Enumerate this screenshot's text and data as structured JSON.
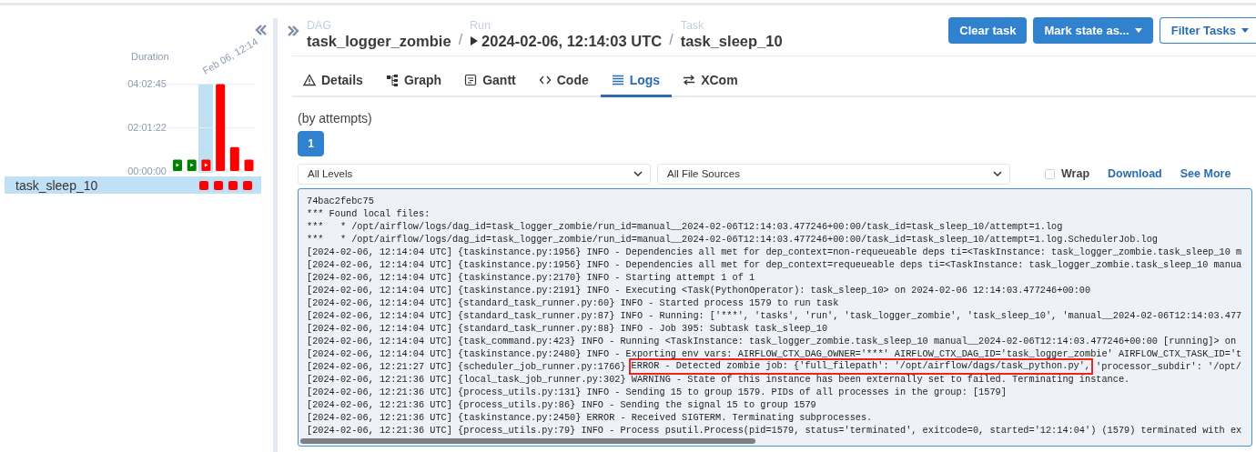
{
  "sidebar": {
    "chart_data": {
      "type": "bar",
      "ylabel": "Duration",
      "ylim": [
        0,
        14565
      ],
      "yticks": [
        {
          "value": 0,
          "label": "00:00:00"
        },
        {
          "value": 7282,
          "label": "02:01:22"
        },
        {
          "value": 14565,
          "label": "04:02:45"
        }
      ],
      "values": [
        1900,
        1900,
        1900,
        14500,
        4000,
        1900
      ]
    },
    "runs": [
      {
        "color": "#008000",
        "manual": true,
        "selected": false
      },
      {
        "color": "#008000",
        "manual": true,
        "selected": false
      },
      {
        "color": "#ff0000",
        "manual": true,
        "selected": true,
        "date_label": "Feb 06, 12:14"
      },
      {
        "color": "#ff0000",
        "manual": false,
        "selected": false
      },
      {
        "color": "#ff0000",
        "manual": false,
        "selected": false
      },
      {
        "color": "#ff0000",
        "manual": false,
        "selected": false
      }
    ],
    "task_row": {
      "label": "task_sleep_10",
      "selected": true,
      "instances": [
        {
          "kind": "empty"
        },
        {
          "kind": "empty"
        },
        {
          "kind": "square",
          "color": "#ff0000"
        },
        {
          "kind": "square",
          "color": "#ff0000"
        },
        {
          "kind": "square",
          "color": "#ff0000"
        },
        {
          "kind": "square",
          "color": "#ff0000"
        }
      ]
    }
  },
  "breadcrumb": [
    {
      "label": "DAG",
      "value": "task_logger_zombie",
      "kind": "text"
    },
    {
      "separator": "/",
      "label": "Run",
      "value": "2024-02-06, 12:14:03 UTC",
      "kind": "run"
    },
    {
      "separator": "/",
      "label": "Task",
      "value": "task_sleep_10",
      "kind": "text"
    }
  ],
  "actions": [
    {
      "label": "Clear task",
      "kind": "primary"
    },
    {
      "label": "Mark state as...",
      "kind": "primary-dropdown"
    },
    {
      "label": "Filter Tasks",
      "kind": "outline-dropdown"
    }
  ],
  "tabs": [
    {
      "label": "Details",
      "selected": false
    },
    {
      "label": "Graph",
      "selected": false
    },
    {
      "label": "Gantt",
      "selected": false
    },
    {
      "label": "Code",
      "selected": false
    },
    {
      "label": "Logs",
      "selected": true
    },
    {
      "label": "XCom",
      "selected": false
    }
  ],
  "logs": {
    "attempts_label": "(by attempts)",
    "attempts": [
      {
        "label": "1",
        "selected": true
      }
    ],
    "level_select": "All Levels",
    "source_select": "All File Sources",
    "wrap": {
      "label": "Wrap",
      "checked": false
    },
    "links": [
      "Download",
      "See More"
    ],
    "lines": [
      {
        "text": "74bac2febc75"
      },
      {
        "text": "*** Found local files:"
      },
      {
        "text": "***   * /opt/airflow/logs/dag_id=task_logger_zombie/run_id=manual__2024-02-06T12:14:03.477246+00:00/task_id=task_sleep_10/attempt=1.log"
      },
      {
        "text": "***   * /opt/airflow/logs/dag_id=task_logger_zombie/run_id=manual__2024-02-06T12:14:03.477246+00:00/task_id=task_sleep_10/attempt=1.log.SchedulerJob.log"
      },
      {
        "text": "[2024-02-06, 12:14:04 UTC] {taskinstance.py:1956} INFO - Dependencies all met for dep_context=non-requeueable deps ti=<TaskInstance: task_logger_zombie.task_sleep_10 m"
      },
      {
        "text": "[2024-02-06, 12:14:04 UTC] {taskinstance.py:1956} INFO - Dependencies all met for dep_context=requeueable deps ti=<TaskInstance: task_logger_zombie.task_sleep_10 manua"
      },
      {
        "text": "[2024-02-06, 12:14:04 UTC] {taskinstance.py:2170} INFO - Starting attempt 1 of 1"
      },
      {
        "text": "[2024-02-06, 12:14:04 UTC] {taskinstance.py:2191} INFO - Executing <Task(PythonOperator): task_sleep_10> on 2024-02-06 12:14:03.477246+00:00"
      },
      {
        "text": "[2024-02-06, 12:14:04 UTC] {standard_task_runner.py:60} INFO - Started process 1579 to run task"
      },
      {
        "text": "[2024-02-06, 12:14:04 UTC] {standard_task_runner.py:87} INFO - Running: ['***', 'tasks', 'run', 'task_logger_zombie', 'task_sleep_10', 'manual__2024-02-06T12:14:03.477"
      },
      {
        "text": "[2024-02-06, 12:14:04 UTC] {standard_task_runner.py:88} INFO - Job 395: Subtask task_sleep_10"
      },
      {
        "text": "[2024-02-06, 12:14:04 UTC] {task_command.py:423} INFO - Running <TaskInstance: task_logger_zombie.task_sleep_10 manual__2024-02-06T12:14:03.477246+00:00 [running]> on"
      },
      {
        "text": "[2024-02-06, 12:14:04 UTC] {taskinstance.py:2480} INFO - Exporting env vars: AIRFLOW_CTX_DAG_OWNER='***' AIRFLOW_CTX_DAG_ID='task_logger_zombie' AIRFLOW_CTX_TASK_ID='t"
      },
      {
        "text": "[2024-02-06, 12:21:27 UTC] {scheduler_job_runner.py:1766}",
        "highlight": "ERROR - Detected zombie job: {'full_filepath': '/opt/airflow/dags/task_python.py',",
        "rest": "'processor_subdir': '/opt/"
      },
      {
        "text": "[2024-02-06, 12:21:36 UTC] {local_task_job_runner.py:302} WARNING - State of this instance has been externally set to failed. Terminating instance."
      },
      {
        "text": "[2024-02-06, 12:21:36 UTC] {process_utils.py:131} INFO - Sending 15 to group 1579. PIDs of all processes in the group: [1579]"
      },
      {
        "text": "[2024-02-06, 12:21:36 UTC] {process_utils.py:86} INFO - Sending the signal 15 to group 1579"
      },
      {
        "text": "[2024-02-06, 12:21:36 UTC] {taskinstance.py:2450} ERROR - Received SIGTERM. Terminating subprocesses."
      },
      {
        "text": "[2024-02-06, 12:21:36 UTC] {process_utils.py:79} INFO - Process psutil.Process(pid=1579, status='terminated', exitcode=0, started='12:14:04') (1579) terminated with ex"
      }
    ]
  }
}
